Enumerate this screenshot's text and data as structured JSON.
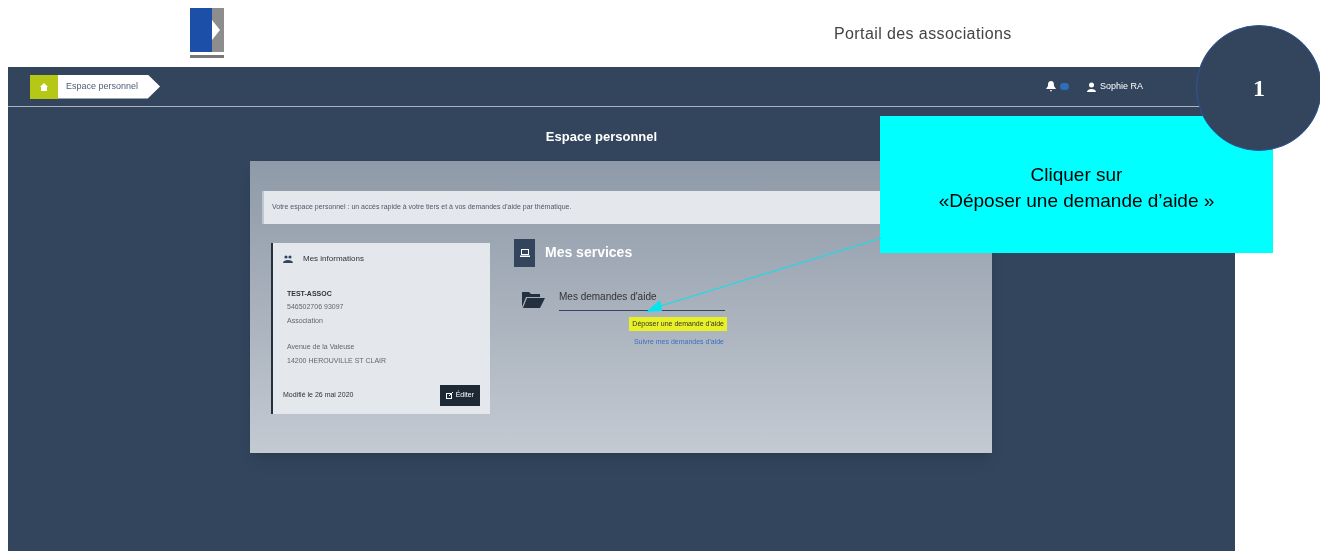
{
  "header": {
    "title": "Portail des associations"
  },
  "breadcrumb": {
    "label": "Espace personnel"
  },
  "user": {
    "name": "Sophie RA"
  },
  "page_title": "Espace personnel",
  "intro": "Votre espace personnel : un accès rapide à votre tiers et à vos demandes d'aide par thématique.",
  "info_card": {
    "title": "Mes informations",
    "lines": [
      "TEST-ASSOC",
      "546502706 93097",
      "Association"
    ],
    "address": [
      "Avenue de la Valeuse",
      "14200 HEROUVILLE ST CLAIR"
    ],
    "modified": "Modifié le 26 mai 2020",
    "edit_button": "Éditer"
  },
  "services": {
    "title": "Mes services",
    "section": "Mes demandes d'aide",
    "links": [
      {
        "label": "Déposer une demande d'aide",
        "highlighted": true
      },
      {
        "label": "Suivre mes demandes d'aide",
        "highlighted": false
      }
    ]
  },
  "callout": {
    "step": "1",
    "lines": [
      "Cliquer sur",
      "«Déposer une demande d’aide »"
    ]
  }
}
